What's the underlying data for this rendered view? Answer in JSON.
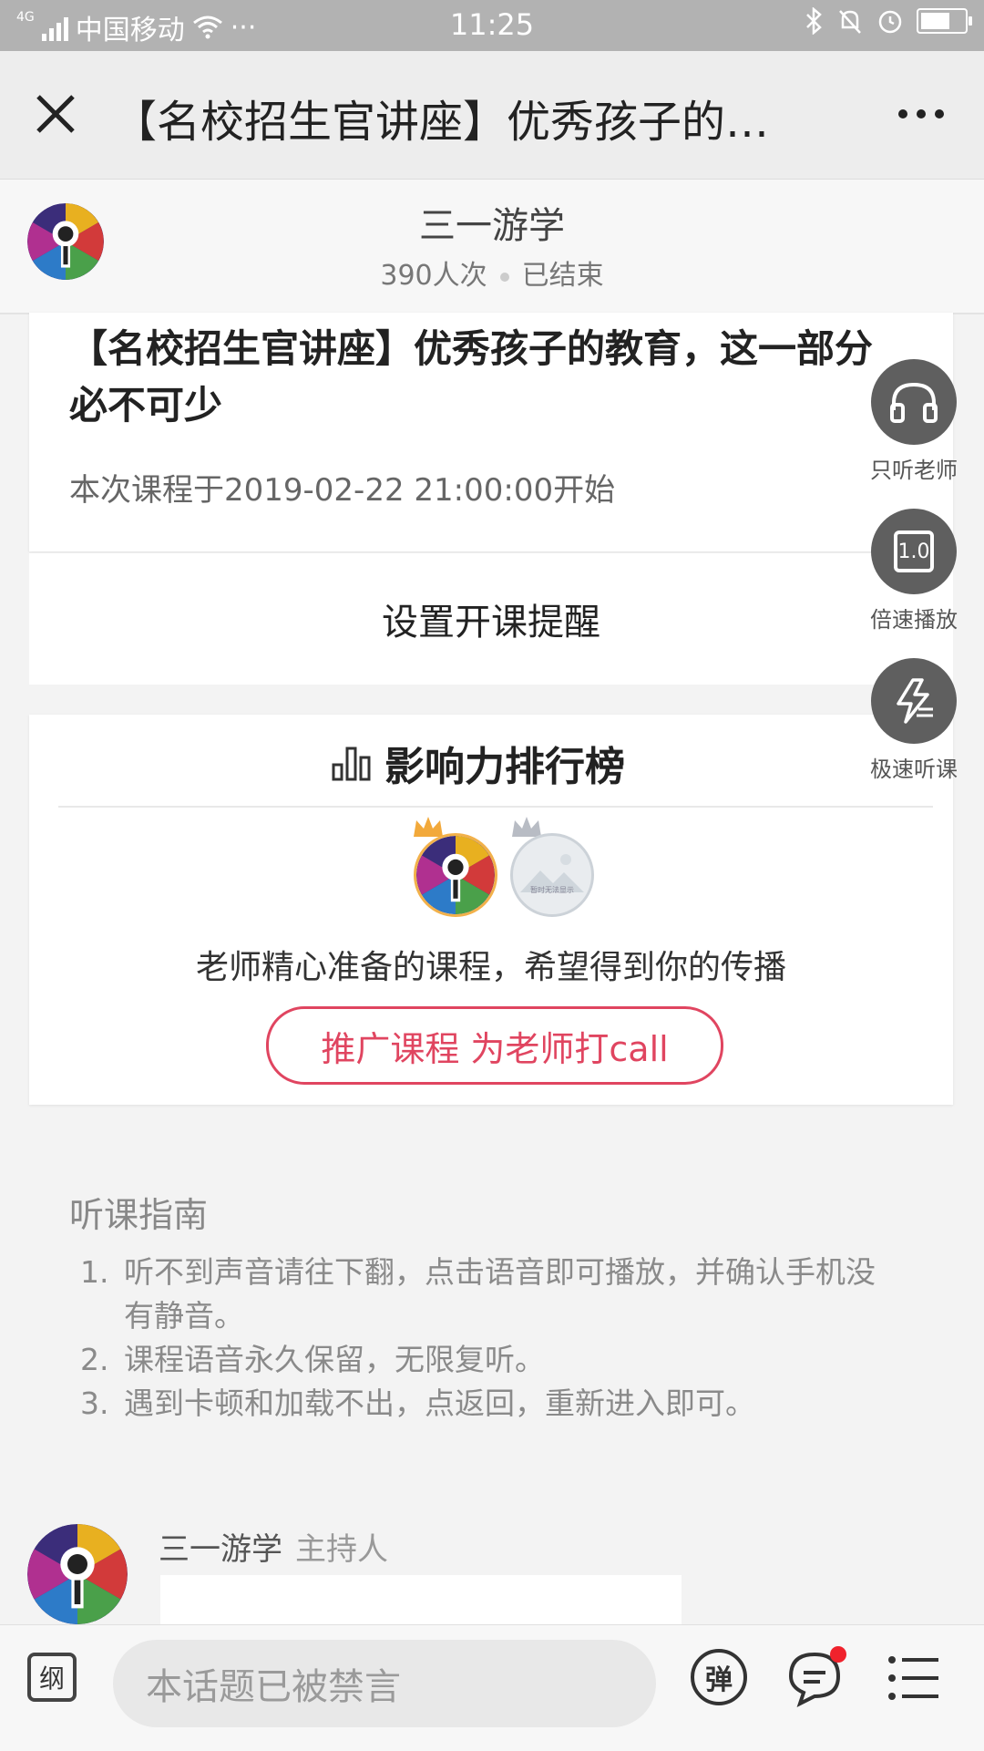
{
  "status_bar": {
    "network": "4G",
    "carrier": "中国移动",
    "more": "···",
    "time": "11:25"
  },
  "nav": {
    "title": "【名校招生官讲座】优秀孩子的…",
    "close_icon": "close-icon",
    "more_icon": "more-icon"
  },
  "host": {
    "name": "三一游学",
    "views": "390人次",
    "status": "已结束"
  },
  "course": {
    "title": "【名校招生官讲座】优秀孩子的教育，这一部分必不可少",
    "start_time": "本次课程于2019-02-22 21:00:00开始",
    "reminder_label": "设置开课提醒"
  },
  "ranking": {
    "title": "影响力排行榜",
    "second_avatar_text": "暂时无法显示",
    "message": "老师精心准备的课程，希望得到你的传播",
    "promo_button": "推广课程 为老师打call"
  },
  "side_buttons": [
    {
      "label": "只听老师",
      "icon": "headphones-icon"
    },
    {
      "label": "倍速播放",
      "icon": "speed-icon",
      "speed": "1.0"
    },
    {
      "label": "极速听课",
      "icon": "lightning-icon"
    }
  ],
  "guide": {
    "title": "听课指南",
    "items": [
      {
        "num": "1.",
        "text": "听不到声音请往下翻，点击语音即可播放，并确认手机没有静音。"
      },
      {
        "num": "2.",
        "text": "课程语音永久保留，无限复听。"
      },
      {
        "num": "3.",
        "text": "遇到卡顿和加载不出，点返回，重新进入即可。"
      }
    ]
  },
  "message": {
    "sender": "三一游学",
    "role": "主持人"
  },
  "bottom_bar": {
    "outline_label": "纲",
    "input_placeholder": "本话题已被禁言",
    "danmu_label": "弹"
  },
  "colors": {
    "accent": "#e04560",
    "fab": "#5f5f5f",
    "status_bar": "#b2b2b2",
    "badge": "#f0222c"
  }
}
